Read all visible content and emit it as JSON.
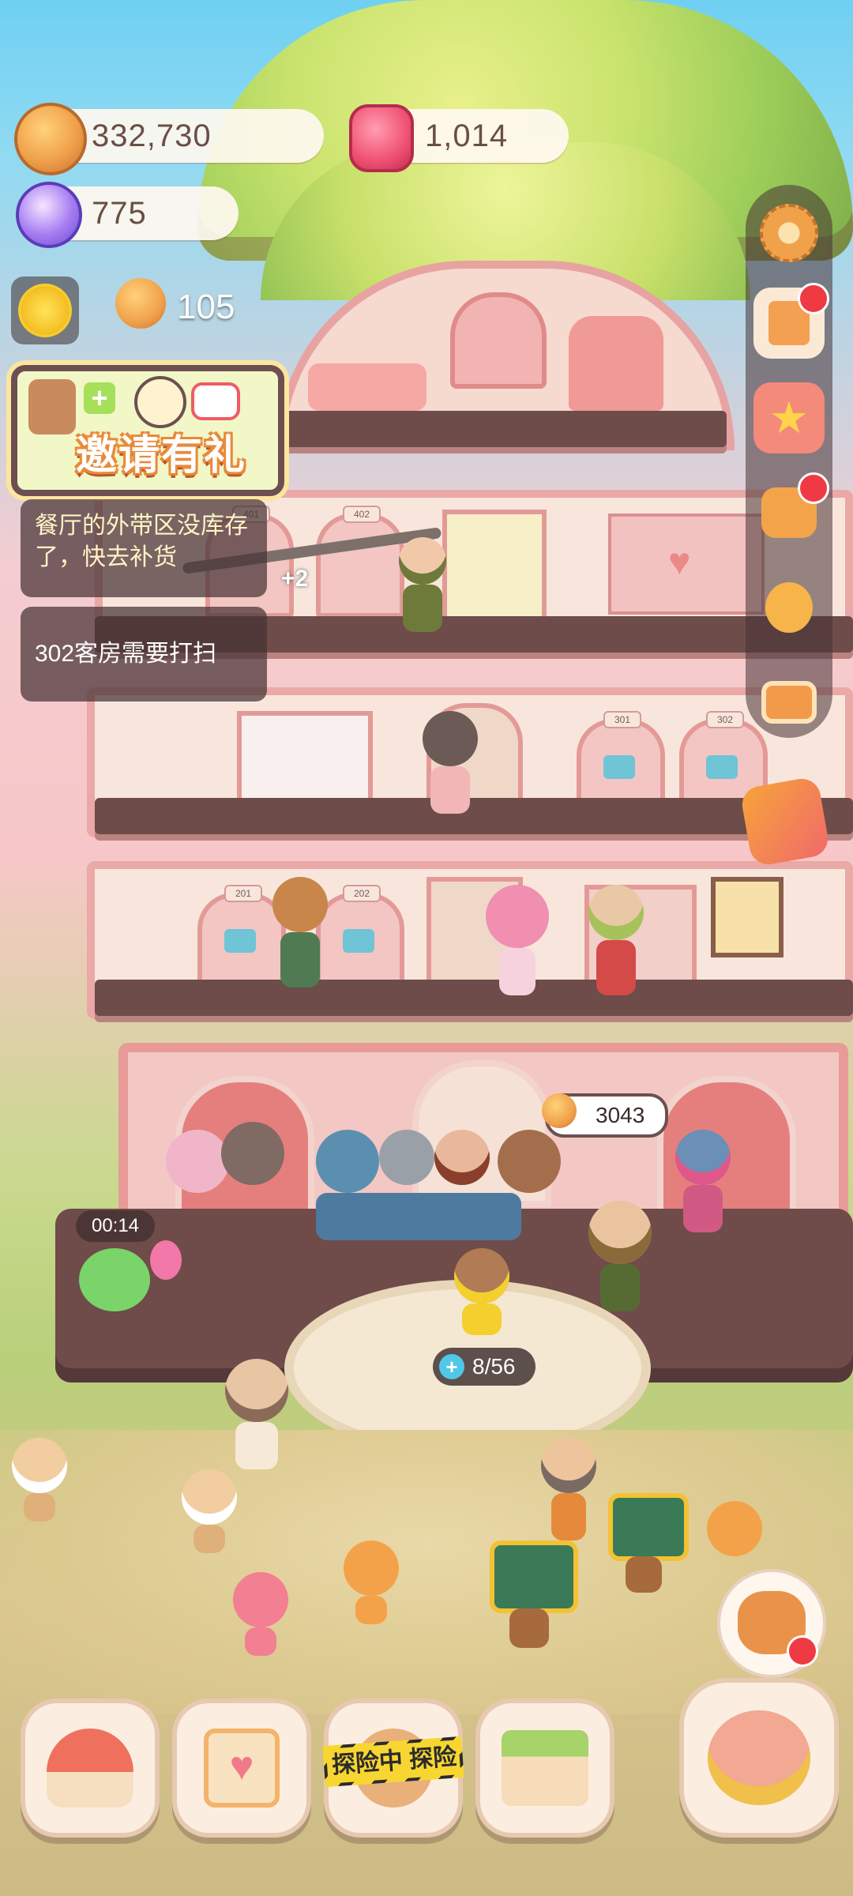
{
  "hud": {
    "coins": "332,730",
    "red_gems": "1,014",
    "purple_gems": "775",
    "cookie_count": "105"
  },
  "invite": {
    "label": "邀请有礼"
  },
  "notices": [
    "餐厅的外带区没库存了，快去补货",
    "302客房需要打扫"
  ],
  "building": {
    "room_numbers": [
      "401",
      "402",
      "301",
      "302",
      "201",
      "202"
    ],
    "chain_bonus": "+2"
  },
  "lobby": {
    "bubble_value": "3043",
    "timer": "00:14",
    "capacity": "8/56",
    "counter_plus": "+"
  },
  "bottom_bar": {
    "explore_label": "探险中 探险"
  },
  "icons": {
    "side": [
      "gear-icon",
      "stamp-card-icon",
      "star-shop-icon",
      "backpack-icon",
      "friends-icon",
      "camera-icon",
      "gift-basket-icon"
    ],
    "bottom": [
      "mushroom-house-icon",
      "diary-icon",
      "explore-icon",
      "shop-icon",
      "fish-clock-icon"
    ]
  },
  "colors": {
    "sky": "#6fd0f2",
    "building_pink": "#f3c7c3",
    "trim": "#e89a98",
    "notification_red": "#ef3a44"
  }
}
